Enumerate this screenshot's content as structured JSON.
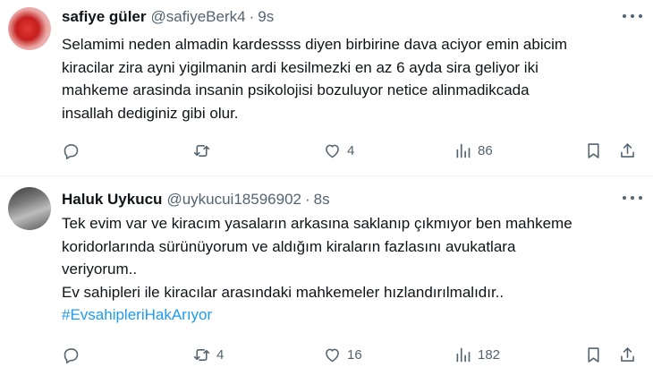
{
  "tweets": [
    {
      "author_name": "safiye güler",
      "handle": "@safiyeBerk4",
      "separator": "·",
      "time": "9s",
      "text_lines": [
        "Selamimi neden almadin kardessss diyen birbirine dava aciyor emin abicim",
        "kiracilar zira ayni yigilmanin ardi kesilmezki en az 6 ayda sira geliyor iki",
        "mahkeme arasinda insanin psikolojisi bozuluyor netice alinmadikcada",
        "insallah dediginiz gibi olur."
      ],
      "hashtag": "",
      "counts": {
        "replies": "",
        "retweets": "",
        "likes": "4",
        "views": "86"
      }
    },
    {
      "author_name": "Haluk Uykucu",
      "handle": "@uykucui18596902",
      "separator": "·",
      "time": "8s",
      "text_lines": [
        "Tek evim var ve kiracım yasaların arkasına saklanıp çıkmıyor ben mahkeme",
        "koridorlarında sürünüyorum ve aldığım kiraların fazlasını avukatlara",
        "veriyorum..",
        "Ev sahipleri ile kiracılar arasındaki mahkemeler hızlandırılmalıdır.."
      ],
      "hashtag": "#EvsahipleriHakArıyor",
      "counts": {
        "replies": "",
        "retweets": "4",
        "likes": "16",
        "views": "182"
      }
    }
  ],
  "icons": {
    "reply": "reply-icon",
    "retweet": "retweet-icon",
    "like": "heart-icon",
    "views": "views-icon",
    "bookmark": "bookmark-icon",
    "share": "share-icon",
    "more": "more-icon"
  },
  "colors": {
    "text": "#0f1419",
    "secondary": "#536471",
    "link": "#1d9bf0",
    "divider": "#eff3f4"
  }
}
